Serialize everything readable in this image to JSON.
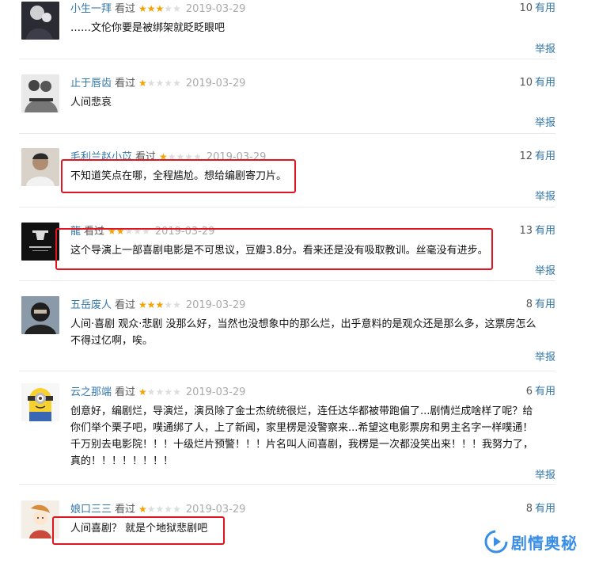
{
  "watched_label": "看过",
  "report_label": "举报",
  "useful_label": "有用",
  "star_glyphs": "★★★★★",
  "colors": {
    "link": "#3377aa",
    "star": "#f4a400",
    "highlight": "#e0151f",
    "watermark": "#3a8ee6"
  },
  "comments": [
    {
      "user": "小生一拜",
      "rating": 3,
      "date": "2019-03-29",
      "useful": "10",
      "text": "……文伦你要是被绑架就眨眨眼吧"
    },
    {
      "user": "止于唇齿",
      "rating": 1,
      "date": "2019-03-29",
      "useful": "10",
      "text": "人间悲哀"
    },
    {
      "user": "毛利兰赵小苡",
      "rating": 1,
      "date": "2019-03-29",
      "useful": "12",
      "text": "不知道笑点在哪，全程尴尬。想给编剧寄刀片。"
    },
    {
      "user": "龍",
      "rating": 2,
      "date": "2019-03-29",
      "useful": "13",
      "text": "这个导演上一部喜剧电影是不可思议，豆瓣3.8分。看来还是没有吸取教训。丝毫没有进步。"
    },
    {
      "user": "五岳废人",
      "rating": 3,
      "date": "2019-03-29",
      "useful": "8",
      "text": "人间·喜剧 观众·悲剧 没那么好，当然也没想象中的那么烂，出乎意料的是观众还是那么多，这票房怎么不得过亿啊，唉。"
    },
    {
      "user": "云之那端",
      "rating": 1,
      "date": "2019-03-29",
      "useful": "6",
      "text": "创意好，编剧烂，导演烂，演员除了金士杰统统很烂，连任达华都被带跑偏了...剧情烂成啥样了呢？给你们举个栗子吧，噗通绑了人，上了新闻，家里楞是没警察来...希望这电影票房和男主名字一样噗通！千万别去电影院！！！十级烂片预警！！！片名叫人间喜剧，我楞是一次都没笑出来！！！我努力了，真的！！！！！！！！"
    },
    {
      "user": "娘口三三",
      "rating": 1,
      "date": "2019-03-29",
      "useful": "8",
      "text": "人间喜剧？ 就是个地狱悲剧吧"
    }
  ],
  "watermark": {
    "text": "剧情奥秘",
    "logo_icon": "play-swirl-icon"
  }
}
